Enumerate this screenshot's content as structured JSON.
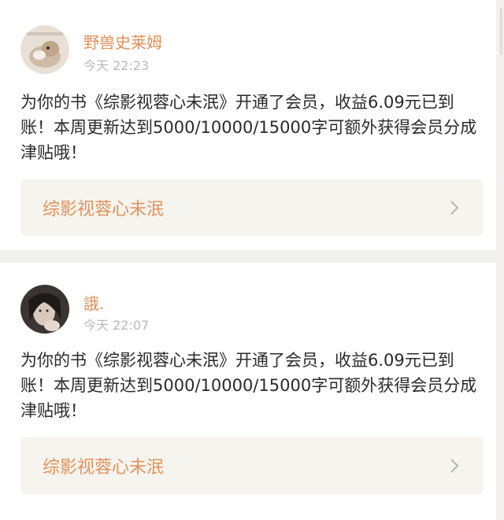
{
  "notifications": [
    {
      "username": "野兽史莱姆",
      "time": "今天 22:23",
      "message": "为你的书《综影视蓉心未泯》开通了会员，收益6.09元已到账！本周更新达到5000/10000/15000字可额外获得会员分成津贴哦！",
      "book_title": "综影视蓉心未泯"
    },
    {
      "username": "誐.",
      "time": "今天 22:07",
      "message": "为你的书《综影视蓉心未泯》开通了会员，收益6.09元已到账！本周更新达到5000/10000/15000字可额外获得会员分成津贴哦！",
      "book_title": "综影视蓉心未泯"
    }
  ],
  "colors": {
    "accent": "#e0915a",
    "background": "#f1f0ee",
    "link_background": "#f6f4ee"
  },
  "icons": [
    "avatar-image",
    "chevron-right-icon"
  ]
}
